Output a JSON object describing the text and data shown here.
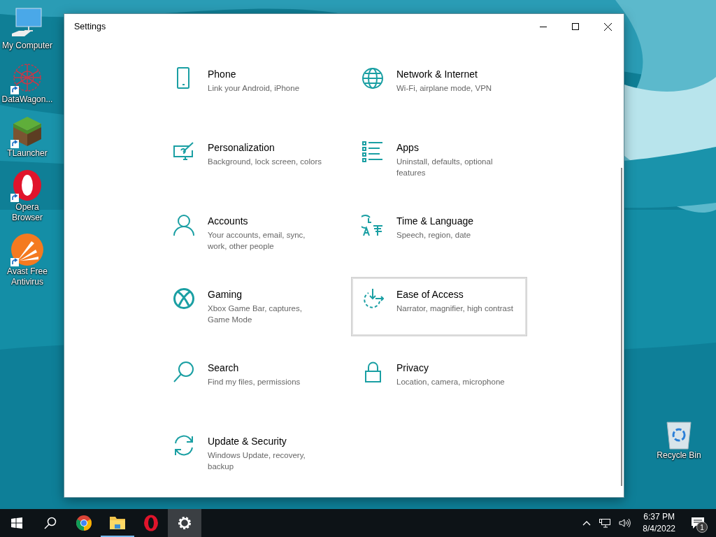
{
  "desktop_icons": [
    {
      "kind": "computer",
      "label": "My Computer",
      "shortcut": false
    },
    {
      "kind": "network",
      "label": "DataWagon...",
      "shortcut": true
    },
    {
      "kind": "cube",
      "label": "TLauncher",
      "shortcut": true
    },
    {
      "kind": "opera",
      "label": "Opera Browser",
      "shortcut": true
    },
    {
      "kind": "avast",
      "label": "Avast Free Antivirus",
      "shortcut": true
    }
  ],
  "recycle_bin": {
    "label": "Recycle Bin"
  },
  "window": {
    "title": "Settings"
  },
  "settings": [
    {
      "kind": "phone",
      "title": "Phone",
      "subtitle": "Link your Android, iPhone",
      "focused": false
    },
    {
      "kind": "globe",
      "title": "Network & Internet",
      "subtitle": "Wi-Fi, airplane mode, VPN",
      "focused": false
    },
    {
      "kind": "brush",
      "title": "Personalization",
      "subtitle": "Background, lock screen, colors",
      "focused": false
    },
    {
      "kind": "list",
      "title": "Apps",
      "subtitle": "Uninstall, defaults, optional features",
      "focused": false
    },
    {
      "kind": "person",
      "title": "Accounts",
      "subtitle": "Your accounts, email, sync, work, other people",
      "focused": false
    },
    {
      "kind": "language",
      "title": "Time & Language",
      "subtitle": "Speech, region, date",
      "focused": false
    },
    {
      "kind": "xbox",
      "title": "Gaming",
      "subtitle": "Xbox Game Bar, captures, Game Mode",
      "focused": false
    },
    {
      "kind": "access",
      "title": "Ease of Access",
      "subtitle": "Narrator, magnifier, high contrast",
      "focused": true
    },
    {
      "kind": "search",
      "title": "Search",
      "subtitle": "Find my files, permissions",
      "focused": false
    },
    {
      "kind": "lock",
      "title": "Privacy",
      "subtitle": "Location, camera, microphone",
      "focused": false
    },
    {
      "kind": "update",
      "title": "Update & Security",
      "subtitle": "Windows Update, recovery, backup",
      "focused": false
    }
  ],
  "taskbar": {
    "apps": [
      {
        "kind": "start",
        "running": false,
        "selected": false
      },
      {
        "kind": "search",
        "running": false,
        "selected": false
      },
      {
        "kind": "chrome",
        "running": false,
        "selected": false
      },
      {
        "kind": "folder",
        "running": true,
        "selected": false
      },
      {
        "kind": "opera",
        "running": false,
        "selected": false
      },
      {
        "kind": "gear",
        "running": false,
        "selected": true
      }
    ],
    "time": "6:37 PM",
    "date": "8/4/2022",
    "notifications": "1"
  }
}
